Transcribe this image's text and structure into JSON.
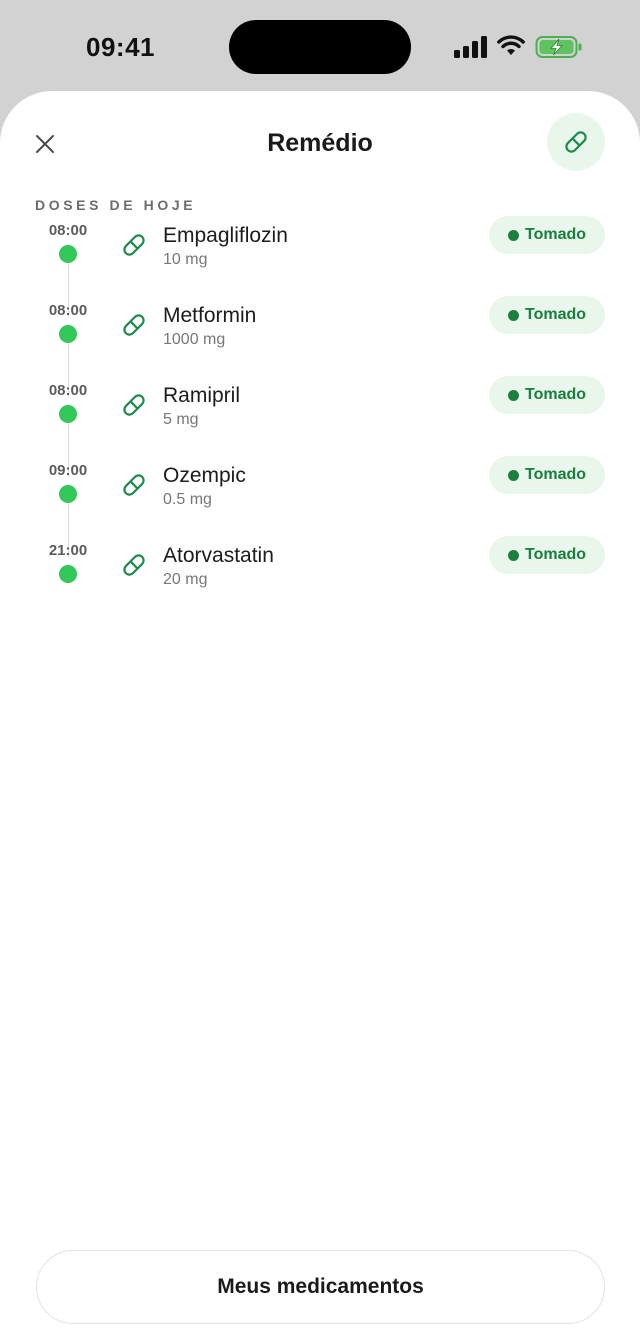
{
  "status_bar": {
    "time": "09:41",
    "icons": [
      "signal-icon",
      "wifi-icon",
      "battery-charging-icon"
    ]
  },
  "header": {
    "title": "Remédio",
    "close_icon": "close-icon",
    "action_icon": "pill-icon"
  },
  "section": {
    "label": "DOSES DE HOJE"
  },
  "doses": [
    {
      "time": "08:00",
      "name": "Empagliflozin",
      "dose": "10 mg",
      "status": "Tomado"
    },
    {
      "time": "08:00",
      "name": "Metformin",
      "dose": "1000 mg",
      "status": "Tomado"
    },
    {
      "time": "08:00",
      "name": "Ramipril",
      "dose": "5 mg",
      "status": "Tomado"
    },
    {
      "time": "09:00",
      "name": "Ozempic",
      "dose": "0.5 mg",
      "status": "Tomado"
    },
    {
      "time": "21:00",
      "name": "Atorvastatin",
      "dose": "20 mg",
      "status": "Tomado"
    }
  ],
  "footer": {
    "button_label": "Meus medicamentos"
  },
  "colors": {
    "accent_green": "#34c759",
    "status_green": "#1a7f3d",
    "pill_bg": "#e9f6ec",
    "icon_green": "#1f8a4c"
  }
}
